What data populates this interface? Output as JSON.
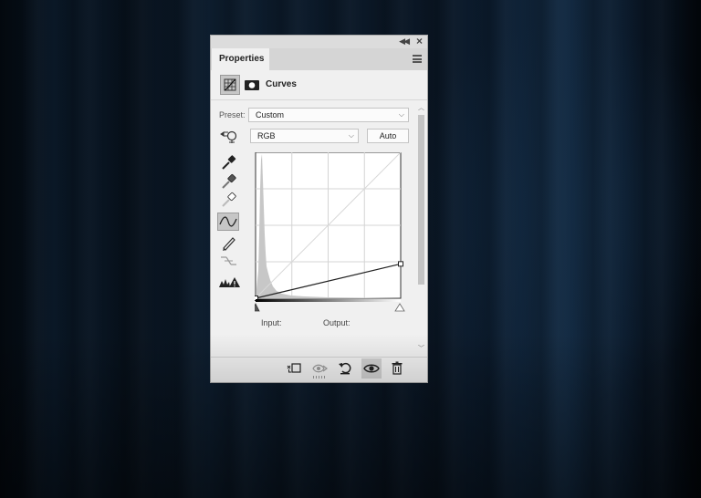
{
  "panel": {
    "tab_label": "Properties",
    "adjustment_title": "Curves"
  },
  "preset": {
    "label": "Preset:",
    "value": "Custom"
  },
  "channel": {
    "value": "RGB"
  },
  "buttons": {
    "auto_label": "Auto"
  },
  "curve": {
    "input_label": "Input:",
    "output_label": "Output:",
    "points": [
      [
        0,
        0
      ],
      [
        255,
        60
      ]
    ]
  },
  "icons": {
    "tools": [
      "target-adjust-icon",
      "eyedropper-black-icon",
      "eyedropper-gray-icon",
      "eyedropper-white-icon",
      "curve-edit-icon",
      "pencil-icon",
      "smooth-curve-icon",
      "clipping-warning-icon"
    ],
    "footer": [
      "clip-to-layer-icon",
      "view-previous-icon",
      "reset-icon",
      "visibility-icon",
      "delete-icon"
    ]
  },
  "colors": {
    "panel_bg": "#f0f0f0",
    "background": "#0a1522"
  }
}
